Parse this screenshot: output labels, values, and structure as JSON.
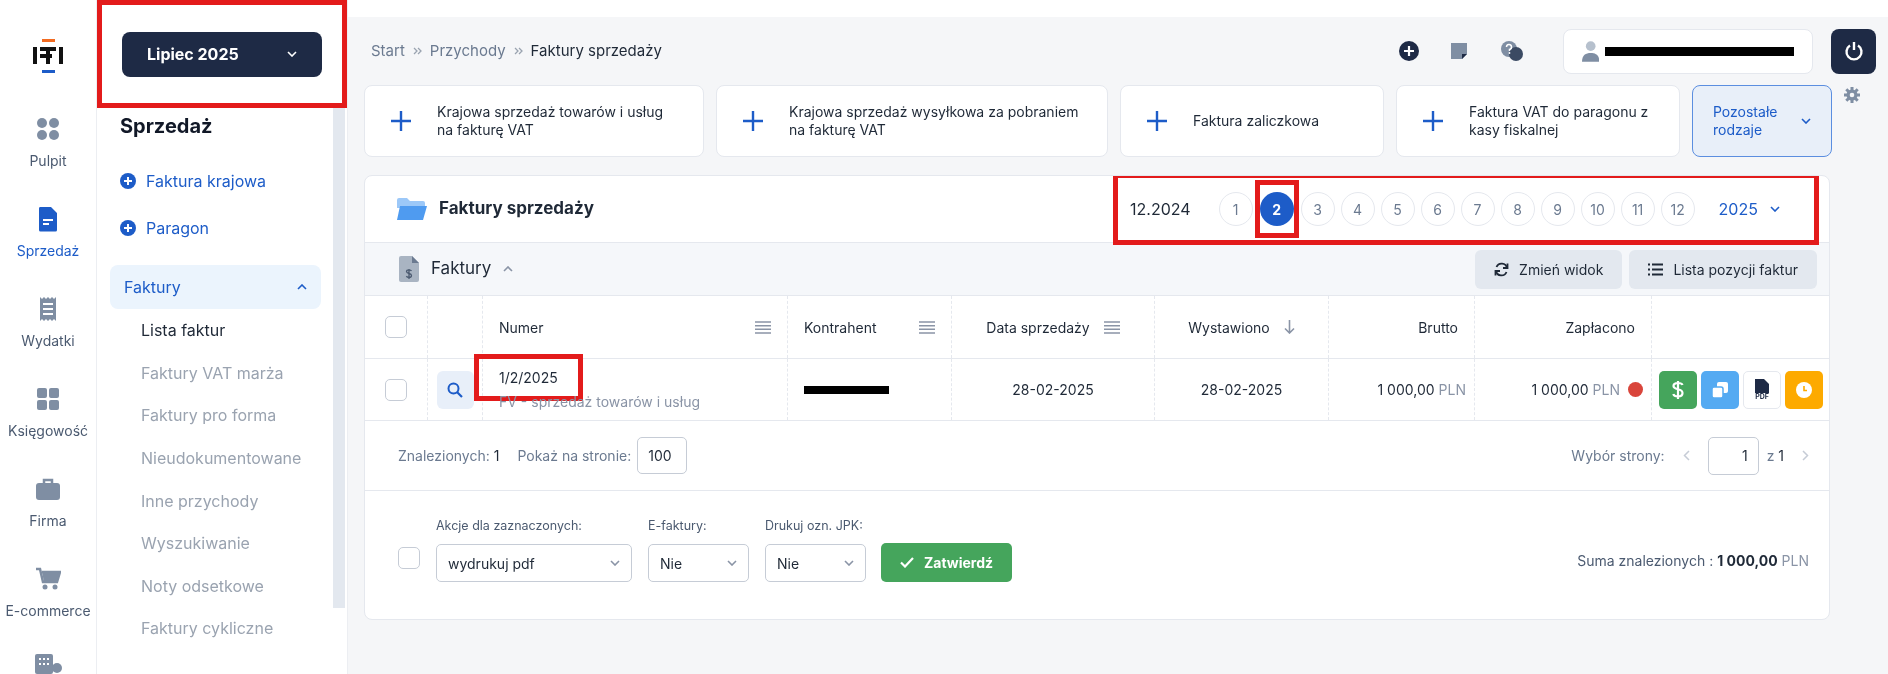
{
  "rail": [
    {
      "label": "Pulpit",
      "selected": false
    },
    {
      "label": "Sprzedaż",
      "selected": true
    },
    {
      "label": "Wydatki",
      "selected": false
    },
    {
      "label": "Księgowość",
      "selected": false
    },
    {
      "label": "Firma",
      "selected": false
    },
    {
      "label": "E-commerce",
      "selected": false
    }
  ],
  "period_selector": {
    "value": "Lipiec 2025",
    "highlighted": true
  },
  "sidebar": {
    "title": "Sprzedaż",
    "quick_links": [
      "Faktura krajowa",
      "Paragon"
    ],
    "group": {
      "label": "Faktury",
      "expanded": true,
      "items": [
        {
          "label": "Lista faktur",
          "selected": true
        },
        {
          "label": "Faktury VAT marża",
          "selected": false
        },
        {
          "label": "Faktury pro forma",
          "selected": false
        },
        {
          "label": "Nieudokumentowane",
          "selected": false
        },
        {
          "label": "Inne przychody",
          "selected": false
        },
        {
          "label": "Wyszukiwanie",
          "selected": false
        },
        {
          "label": "Noty odsetkowe",
          "selected": false
        },
        {
          "label": "Faktury cykliczne",
          "selected": false
        }
      ]
    }
  },
  "breadcrumb": [
    "Start",
    "Przychody",
    "Faktury sprzedaży"
  ],
  "quick_actions": [
    "Krajowa sprzedaż towarów i usług na fakturę VAT",
    "Krajowa sprzedaż wysyłkowa za pobraniem na fakturę VAT",
    "Faktura zaliczkowa",
    "Faktura VAT do paragonu z kasy fiskalnej"
  ],
  "more_types": "Pozostałe rodzaje",
  "panel": {
    "title": "Faktury sprzedaży",
    "month_picker": {
      "highlighted": true,
      "previous": "12.2024",
      "year": "2025",
      "months": [
        {
          "label": "1",
          "selected": false,
          "highlighted": false
        },
        {
          "label": "2",
          "selected": true,
          "highlighted": true
        },
        {
          "label": "3",
          "selected": false,
          "highlighted": false
        },
        {
          "label": "4",
          "selected": false,
          "highlighted": false
        },
        {
          "label": "5",
          "selected": false,
          "highlighted": false
        },
        {
          "label": "6",
          "selected": false,
          "highlighted": false
        },
        {
          "label": "7",
          "selected": false,
          "highlighted": false
        },
        {
          "label": "8",
          "selected": false,
          "highlighted": false
        },
        {
          "label": "9",
          "selected": false,
          "highlighted": false
        },
        {
          "label": "10",
          "selected": false,
          "highlighted": false
        },
        {
          "label": "11",
          "selected": false,
          "highlighted": false
        },
        {
          "label": "12",
          "selected": false,
          "highlighted": false
        }
      ]
    },
    "section": {
      "title": "Faktury",
      "expanded": true
    },
    "buttons": [
      "Zmień widok",
      "Lista pozycji faktur"
    ],
    "table": {
      "select_all": {
        "checked": false
      },
      "columns": [
        {
          "label": "Numer",
          "menu": true,
          "sorted": false
        },
        {
          "label": "Kontrahent",
          "menu": true,
          "sorted": false
        },
        {
          "label": "Data sprzedaży",
          "menu": true,
          "sorted": false
        },
        {
          "label": "Wystawiono",
          "menu": false,
          "sorted": true
        },
        {
          "label": "Brutto",
          "menu": false,
          "sorted": false
        },
        {
          "label": "Zapłacono",
          "menu": false,
          "sorted": false
        }
      ],
      "rows": [
        {
          "checked": false,
          "number": "1/2/2025",
          "number_highlighted": true,
          "type": "FV - sprzedaż towarów i usług",
          "contractor_redacted": true,
          "sale_date": "28-02-2025",
          "issued": "28-02-2025",
          "gross": "1 000,00",
          "gross_currency": "PLN",
          "paid": "1 000,00",
          "paid_currency": "PLN",
          "status_dot": {
            "color": "#d9453b"
          },
          "actions": [
            {
              "kind": "payment"
            },
            {
              "kind": "copy"
            },
            {
              "kind": "pdf",
              "label": "PDF"
            },
            {
              "kind": "reminder"
            }
          ]
        }
      ]
    },
    "footer": {
      "found_label": "Znalezionych:",
      "found": "1",
      "per_page_label": "Pokaż na stronie:",
      "per_page": "100",
      "page_label": "Wybór strony:",
      "page": "1",
      "of": "z",
      "pages": "1"
    },
    "bulk": {
      "checked": false,
      "fields": [
        {
          "label": "Akcje dla zaznaczonych:",
          "value": "wydrukuj pdf"
        },
        {
          "label": "E-faktury:",
          "value": "Nie"
        },
        {
          "label": "Drukuj ozn. JPK:",
          "value": "Nie"
        }
      ],
      "submit": "Zatwierdź",
      "sum_label": "Suma znalezionych :",
      "sum": "1 000,00",
      "sum_currency": "PLN"
    }
  },
  "user": {
    "redacted": true
  }
}
